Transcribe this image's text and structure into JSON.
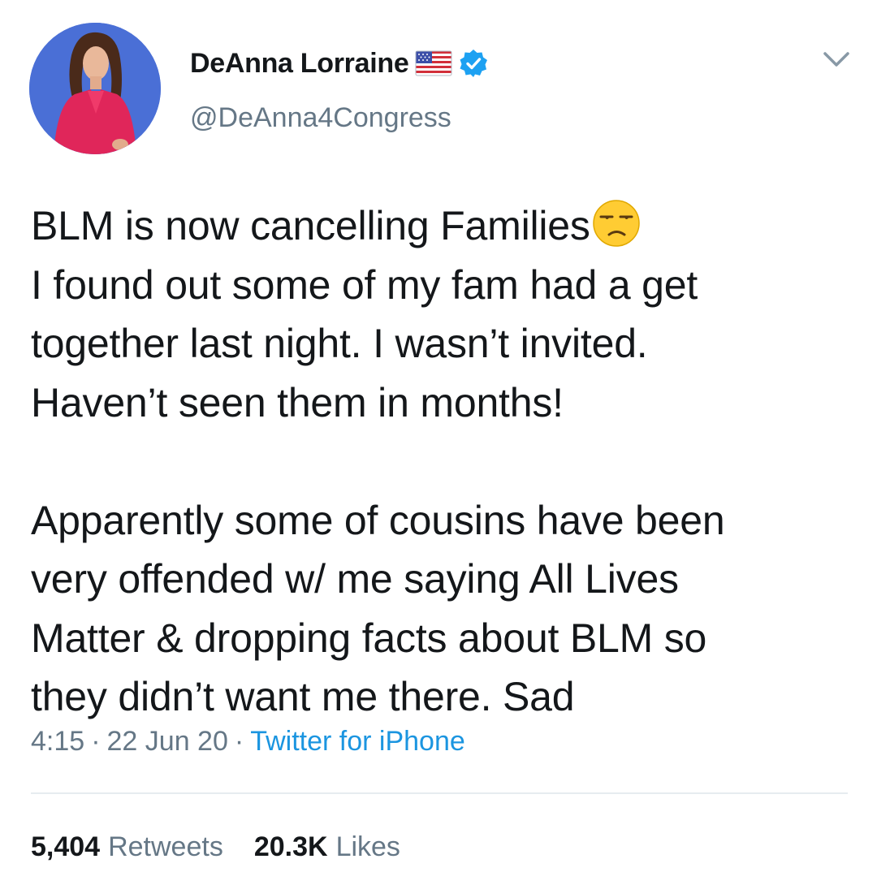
{
  "tweet": {
    "author": {
      "display_name": "DeAnna Lorraine",
      "handle": "@DeAnna4Congress",
      "verified": true,
      "name_badge_icon": "us-flag-icon"
    },
    "text_lines": [
      "BLM is now cancelling Families",
      "I found out some of my fam had a get",
      "together last night. I wasn’t invited.",
      "Haven’t seen them in months!",
      "",
      "Apparently some of cousins have been",
      "very offended w/ me saying All Lives",
      "Matter & dropping facts about BLM so",
      "they didn’t want me there. Sad"
    ],
    "emoji_after_line_1": "unamused-face-icon",
    "time": "4:15",
    "date": "22 Jun 20",
    "separator": "·",
    "source": "Twitter for iPhone",
    "stats": {
      "retweets_count": "5,404",
      "retweets_label": "Retweets",
      "likes_count": "20.3K",
      "likes_label": "Likes"
    }
  },
  "colors": {
    "text": "#14171a",
    "secondary": "#657786",
    "link": "#1b95e0",
    "verified": "#1da1f2",
    "divider": "#e6ecf0",
    "avatar_bg": "#4a6fd6"
  }
}
